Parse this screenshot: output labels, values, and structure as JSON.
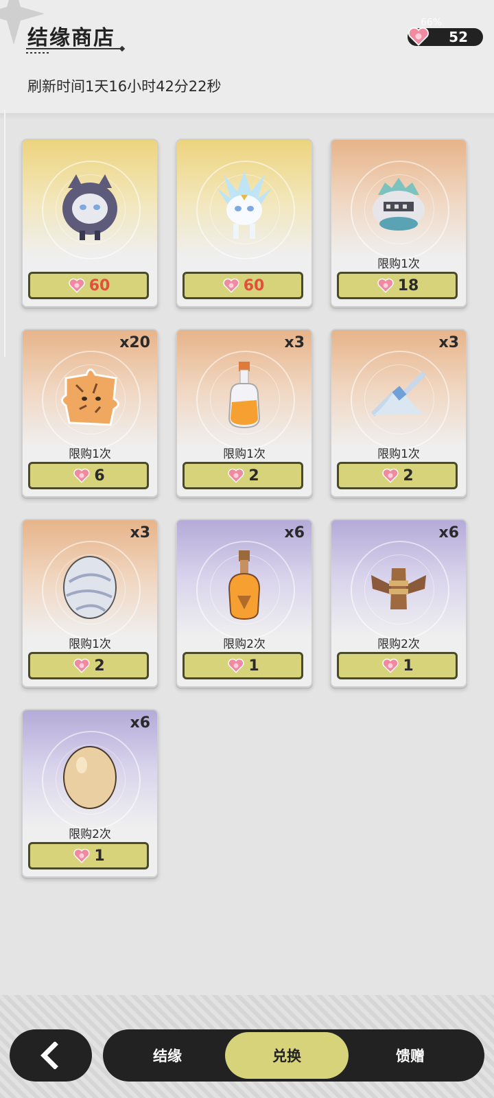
{
  "header": {
    "title": "结缘商店",
    "refresh_text": "刷新时间1天16小时42分22秒",
    "battery": "66%",
    "currency_value": "52"
  },
  "items": [
    {
      "qty": "",
      "limit": "",
      "price": "60",
      "price_color": "#e0503a",
      "bg": "gold",
      "art": "dark-cat-pet"
    },
    {
      "qty": "",
      "limit": "",
      "price": "60",
      "price_color": "#e0503a",
      "bg": "gold",
      "art": "white-fox-pet"
    },
    {
      "qty": "",
      "limit": "限购1次",
      "price": "18",
      "price_color": "#2a2a2a",
      "bg": "orange",
      "art": "knight-helmet-pet"
    },
    {
      "qty": "x20",
      "limit": "限购1次",
      "price": "6",
      "price_color": "#2a2a2a",
      "bg": "orange",
      "art": "tiger-puzzle-piece"
    },
    {
      "qty": "x3",
      "limit": "限购1次",
      "price": "2",
      "price_color": "#2a2a2a",
      "bg": "orange",
      "art": "orange-potion-bottle"
    },
    {
      "qty": "x3",
      "limit": "限购1次",
      "price": "2",
      "price_color": "#2a2a2a",
      "bg": "orange",
      "art": "blue-scroll-bundle"
    },
    {
      "qty": "x3",
      "limit": "限购1次",
      "price": "2",
      "price_color": "#2a2a2a",
      "bg": "orange",
      "art": "silver-egg"
    },
    {
      "qty": "x6",
      "limit": "限购2次",
      "price": "1",
      "price_color": "#2a2a2a",
      "bg": "purple",
      "art": "amber-potion-bottle"
    },
    {
      "qty": "x6",
      "limit": "限购2次",
      "price": "1",
      "price_color": "#2a2a2a",
      "bg": "purple",
      "art": "brown-bundle"
    },
    {
      "qty": "x6",
      "limit": "限购2次",
      "price": "1",
      "price_color": "#2a2a2a",
      "bg": "purple",
      "art": "plain-egg"
    }
  ],
  "nav": {
    "back_icon": "chevron-left-icon",
    "tabs": [
      {
        "label": "结缘",
        "active": false
      },
      {
        "label": "兑换",
        "active": true
      },
      {
        "label": "馈赠",
        "active": false
      }
    ]
  },
  "colors": {
    "accent": "#d6d37a",
    "dark": "#222222",
    "price_red": "#e0503a"
  }
}
